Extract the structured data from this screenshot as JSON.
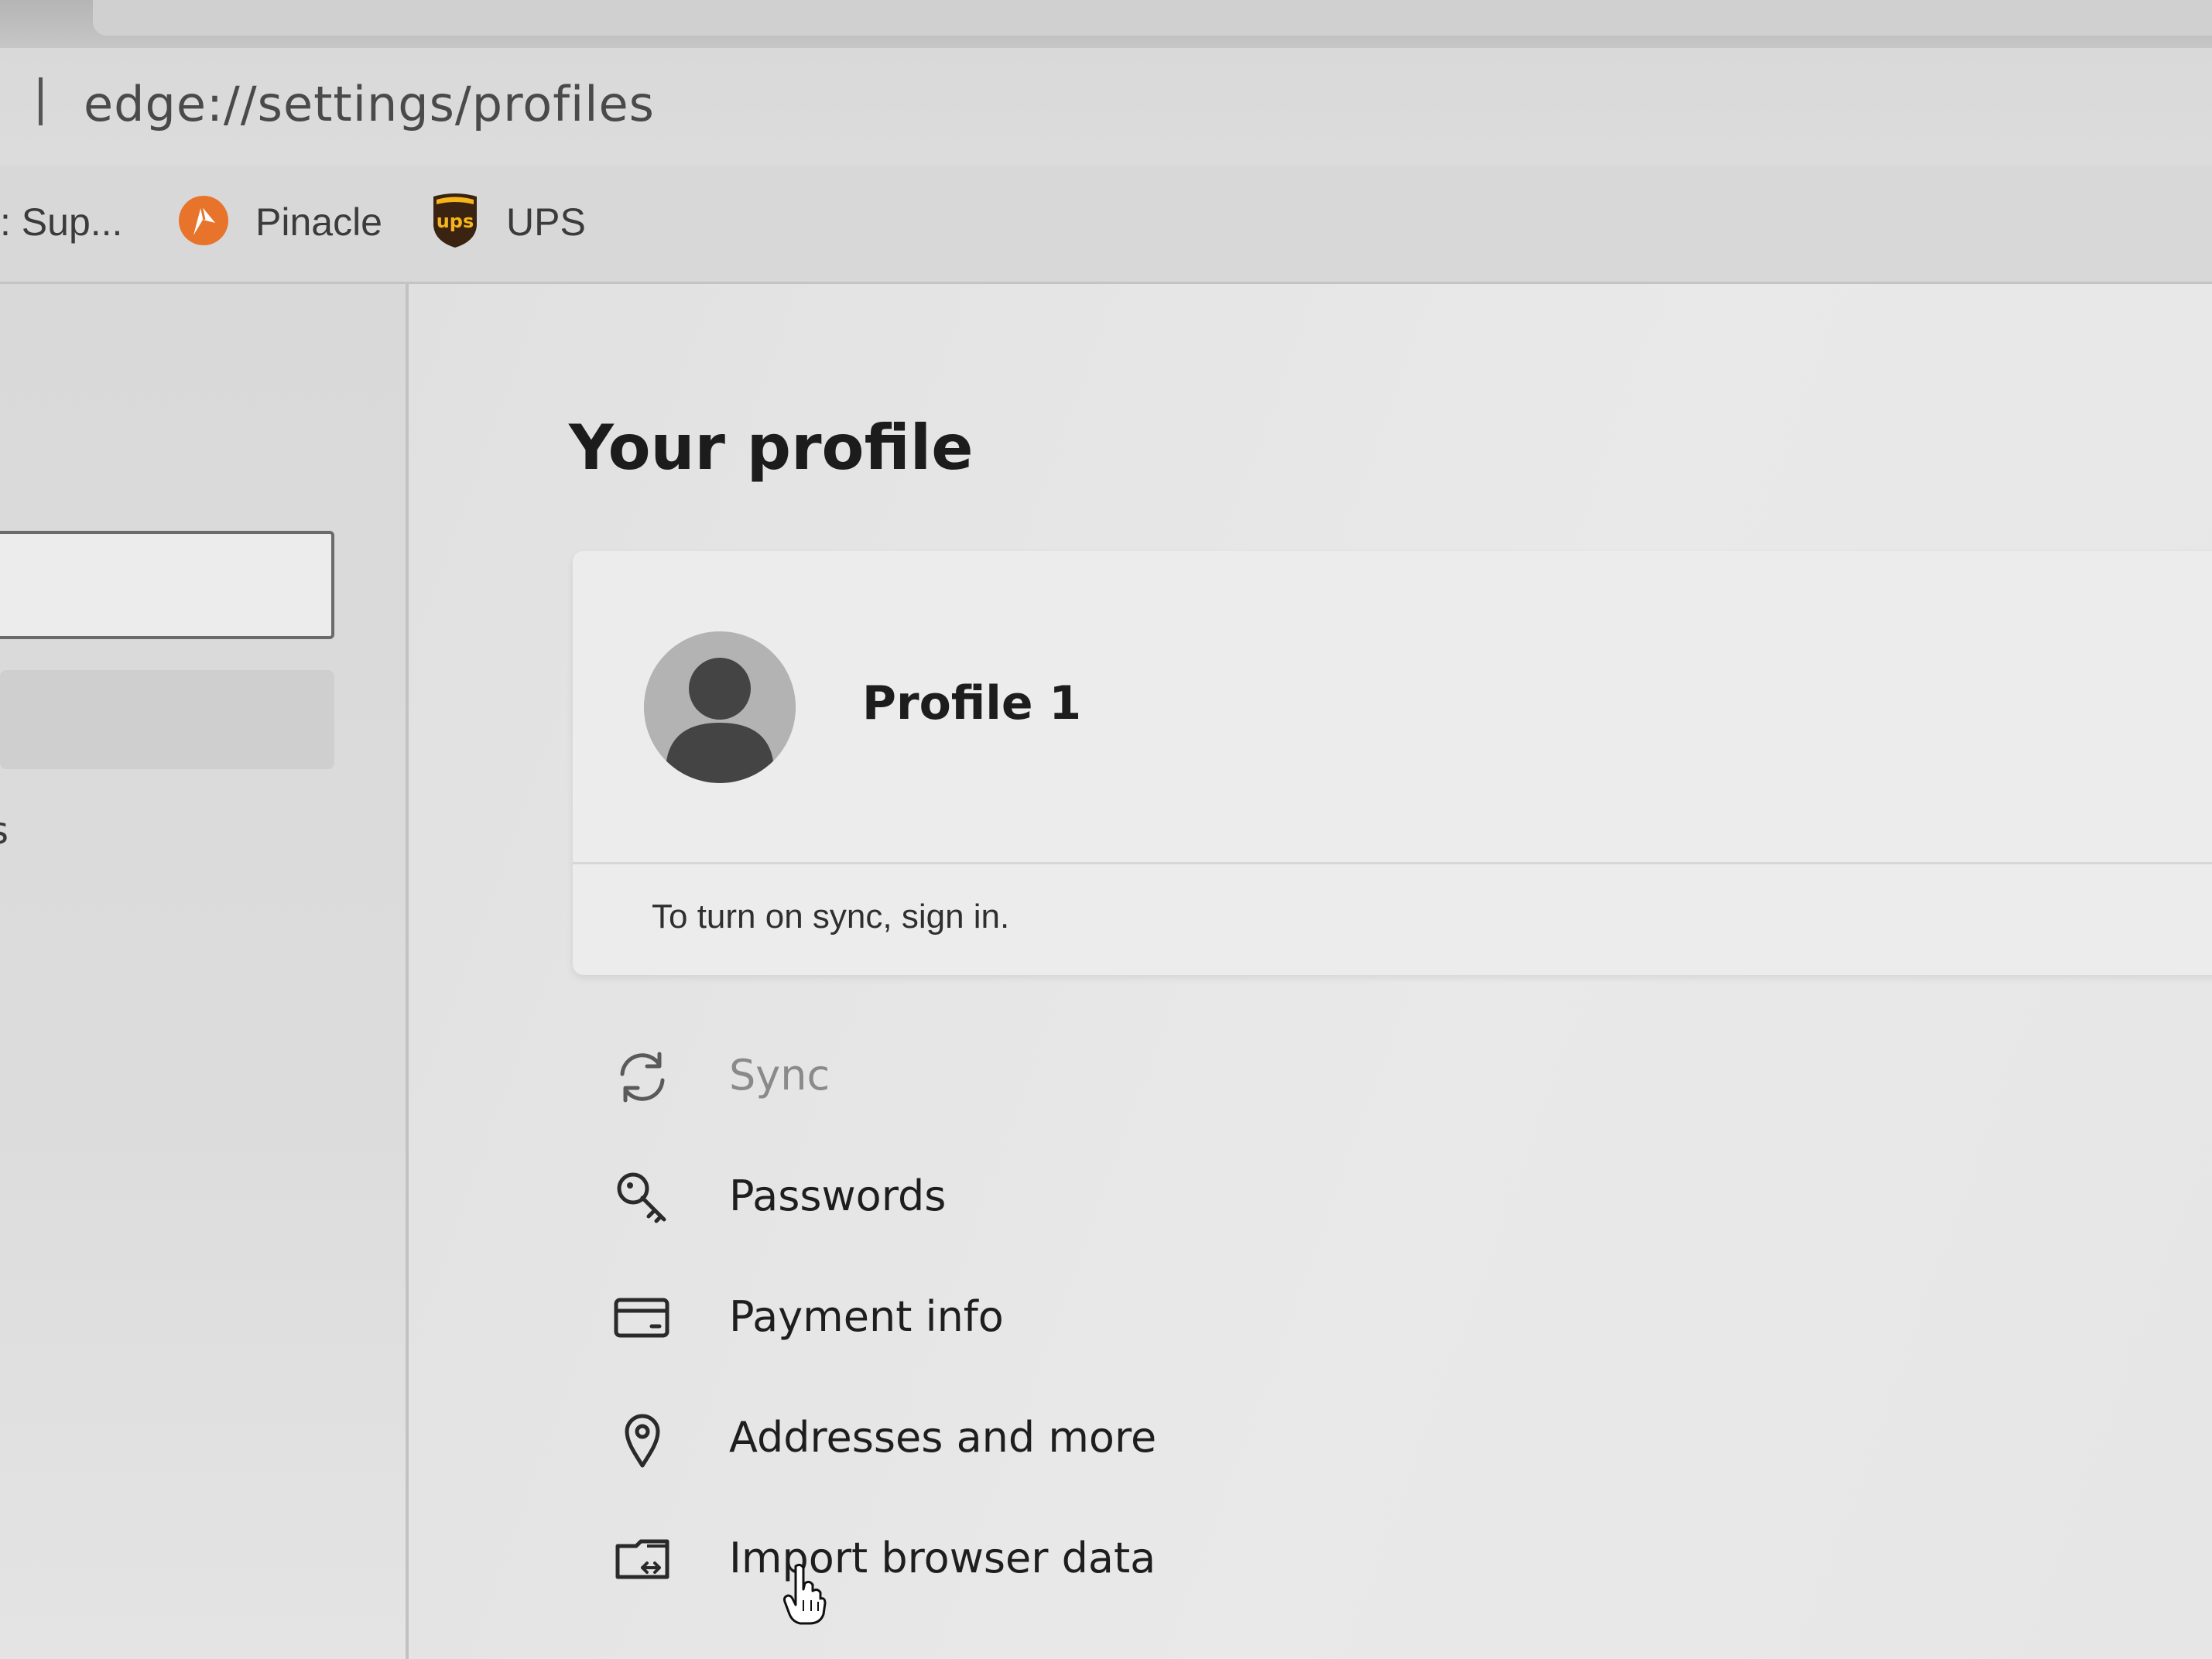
{
  "browser": {
    "url": "edge://settings/profiles"
  },
  "favorites": {
    "items": [
      {
        "label": ": Sup...",
        "icon": "truncated-favorite"
      },
      {
        "label": "Pinacle",
        "icon": "pinacle-logo-icon"
      },
      {
        "label": "UPS",
        "icon": "ups-logo-icon"
      }
    ]
  },
  "sidebar": {
    "fragment_text": "s"
  },
  "main": {
    "title": "Your profile",
    "profile": {
      "name": "Profile 1",
      "sync_message": "To turn on sync, sign in."
    },
    "menu": [
      {
        "label": "Sync",
        "icon": "sync-icon",
        "enabled": false
      },
      {
        "label": "Passwords",
        "icon": "key-icon",
        "enabled": true
      },
      {
        "label": "Payment info",
        "icon": "credit-card-icon",
        "enabled": true
      },
      {
        "label": "Addresses and more",
        "icon": "location-pin-icon",
        "enabled": true
      },
      {
        "label": "Import browser data",
        "icon": "import-icon",
        "enabled": true
      }
    ]
  },
  "colors": {
    "background": "#e4e4e4",
    "card": "#ececec",
    "pinacle_orange": "#e8742c",
    "ups_brown": "#3b2312",
    "ups_gold": "#f5b51b"
  }
}
